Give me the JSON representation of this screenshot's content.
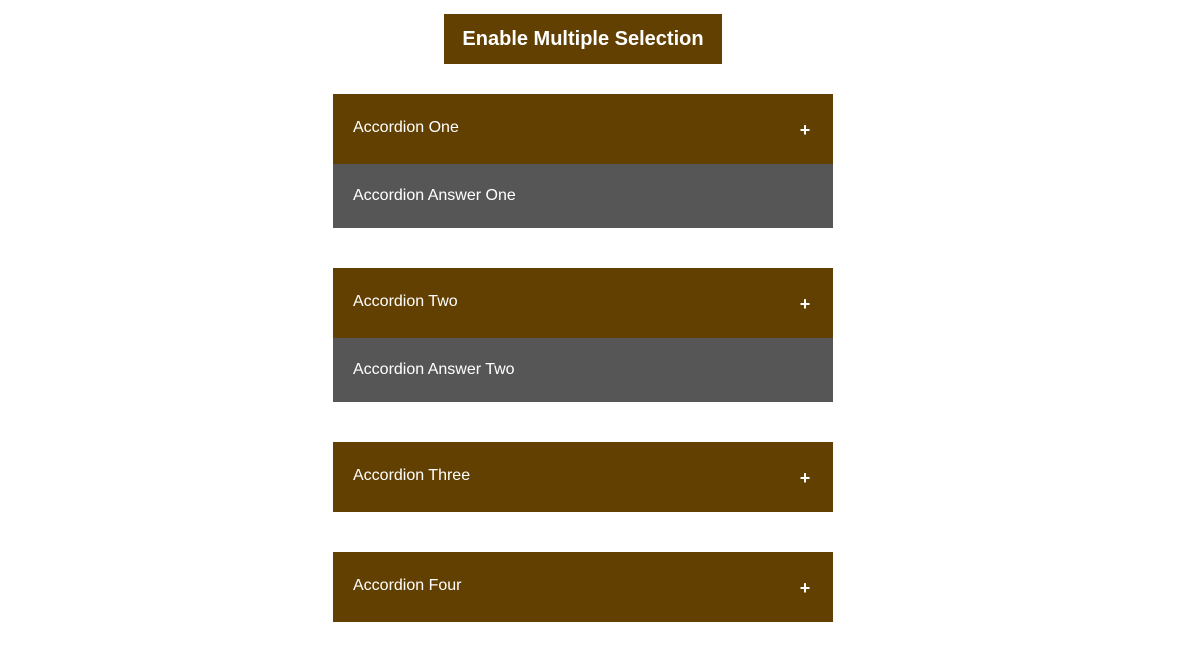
{
  "toggle": {
    "label": "Enable Multiple Selection"
  },
  "accordion": {
    "items": [
      {
        "title": "Accordion One",
        "icon": "+",
        "answer": "Accordion Answer One",
        "expanded": true
      },
      {
        "title": "Accordion Two",
        "icon": "+",
        "answer": "Accordion Answer Two",
        "expanded": true
      },
      {
        "title": "Accordion Three",
        "icon": "+",
        "expanded": false
      },
      {
        "title": "Accordion Four",
        "icon": "+",
        "expanded": false
      }
    ]
  },
  "colors": {
    "header": "#624001",
    "answer": "#575657",
    "text": "#ffffff"
  }
}
